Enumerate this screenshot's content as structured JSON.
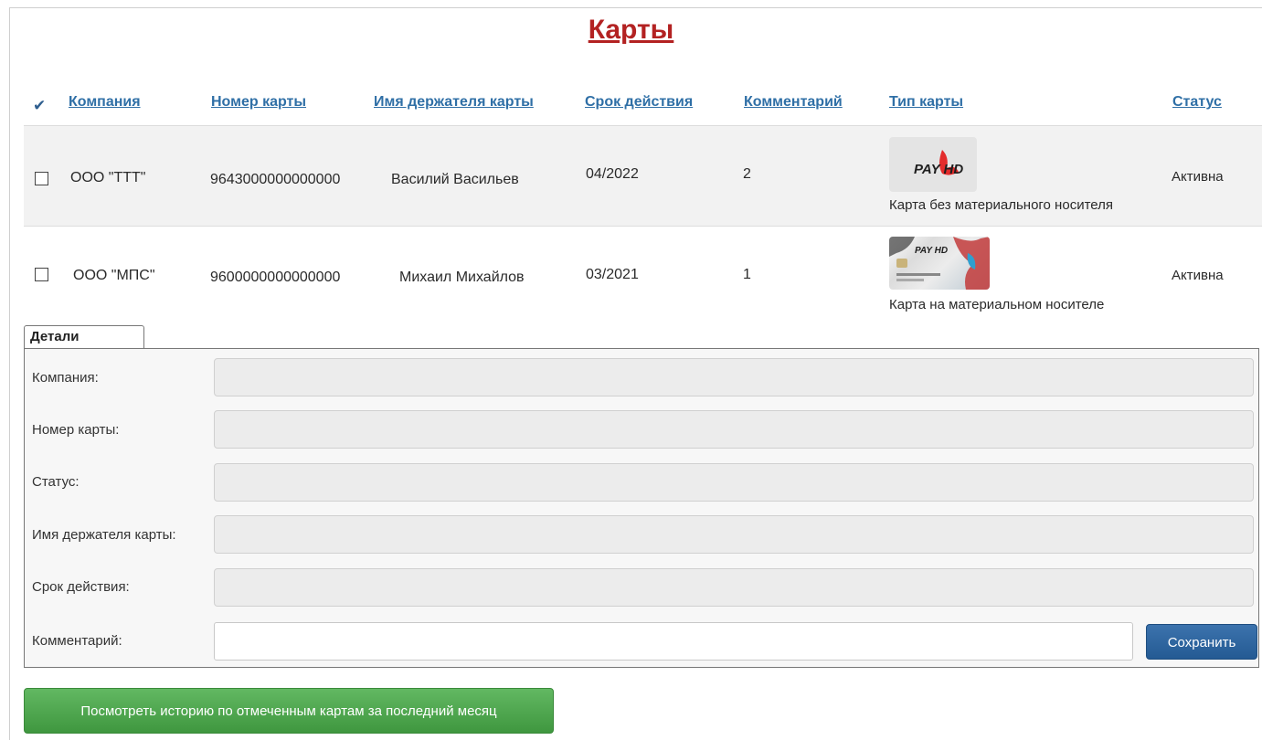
{
  "page": {
    "title": "Карты"
  },
  "table": {
    "check_all_symbol": "✔",
    "columns": {
      "company": "Компания",
      "card_number": "Номер карты",
      "holder": "Имя держателя карты",
      "expiry": "Срок действия",
      "comment": "Комментарий",
      "card_type": "Тип карты",
      "status": "Статус"
    },
    "rows": [
      {
        "checked": false,
        "company": "ООО \"ТТТ\"",
        "card_number": "9643000000000000",
        "holder": "Василий Васильев",
        "expiry": "04/2022",
        "comment": "2",
        "card_type": "Карта без материального носителя",
        "card_logo": "PAY HD",
        "status": "Активна"
      },
      {
        "checked": false,
        "company": "ООО \"МПС\"",
        "card_number": "9600000000000000",
        "holder": "Михаил Михайлов",
        "expiry": "03/2021",
        "comment": "1",
        "card_type": "Карта на материальном носителе",
        "card_logo": "PAY HD",
        "status": "Активна"
      }
    ]
  },
  "details": {
    "tab_label": "Детали",
    "fields": {
      "company": {
        "label": "Компания:",
        "value": ""
      },
      "card_number": {
        "label": "Номер карты:",
        "value": ""
      },
      "status": {
        "label": "Статус:",
        "value": ""
      },
      "holder": {
        "label": "Имя держателя карты:",
        "value": ""
      },
      "expiry": {
        "label": "Срок действия:",
        "value": ""
      },
      "comment": {
        "label": "Комментарий:",
        "value": ""
      }
    },
    "save_label": "Сохранить"
  },
  "actions": {
    "history_label": "Посмотреть историю по отмеченным картам за последний месяц"
  },
  "colors": {
    "title": "#b32222",
    "column_link": "#2f6fa6",
    "save_button": "#2d64a0",
    "history_button": "#4aa84a",
    "row_alt_bg": "#f2f2f2"
  },
  "icons": {
    "check_all": "checkmark-icon",
    "card_virtual": "pay-hd-virtual-card-icon",
    "card_physical": "pay-hd-physical-card-icon"
  }
}
